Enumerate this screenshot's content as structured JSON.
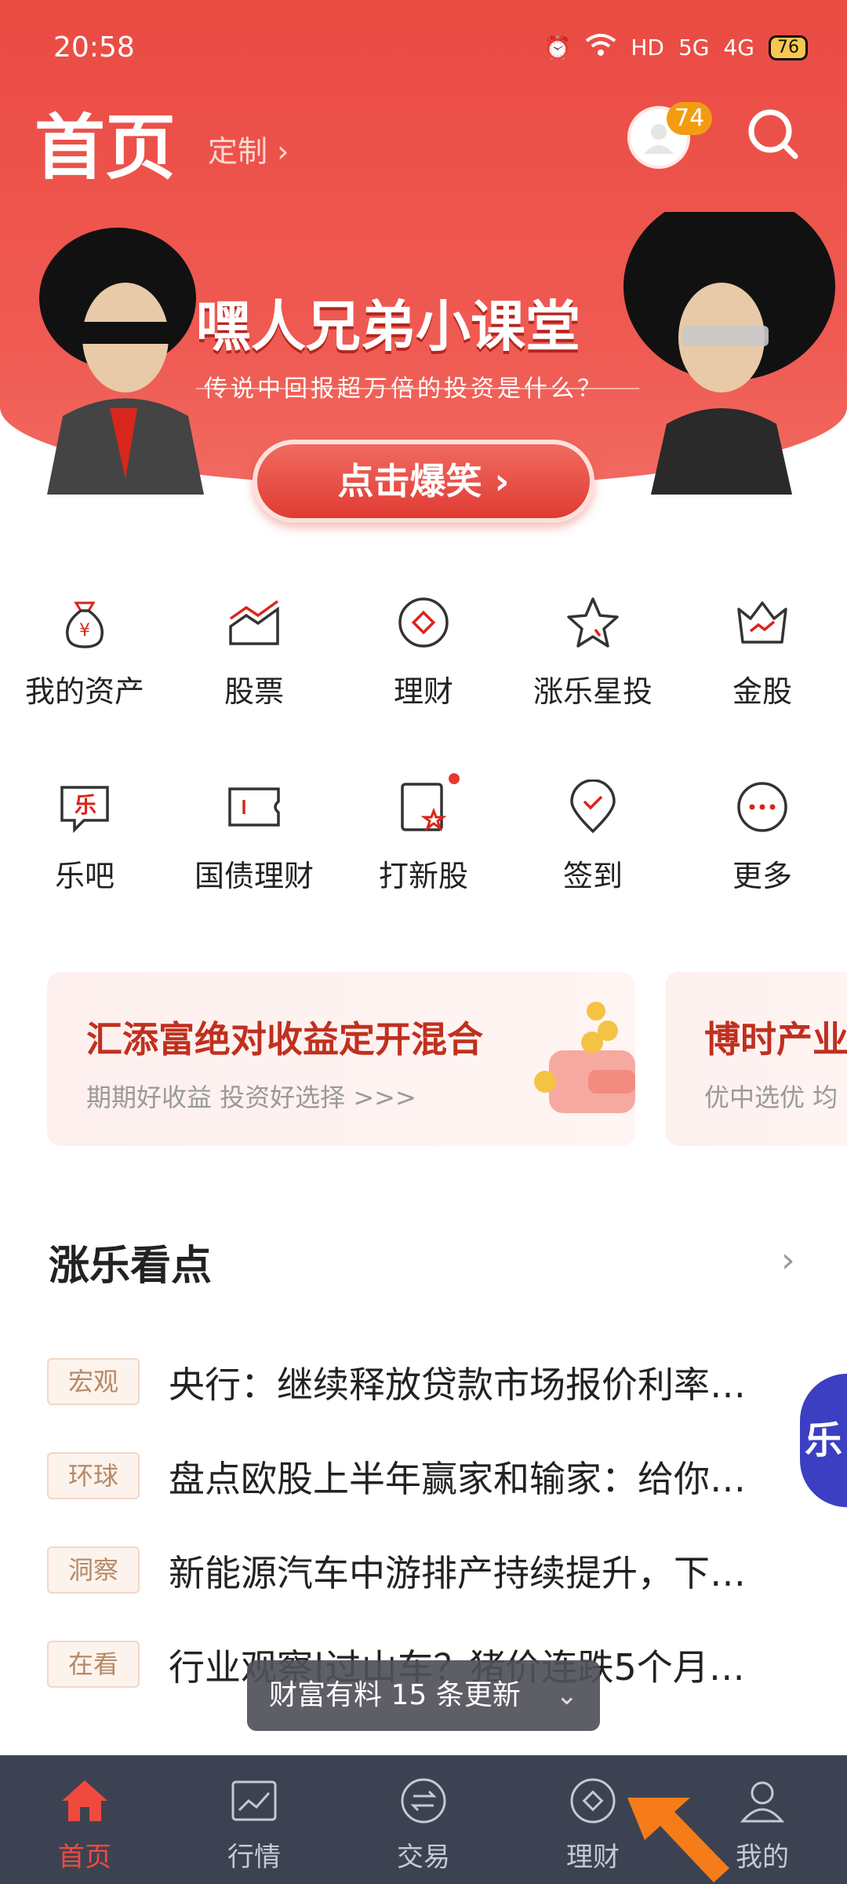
{
  "status_bar": {
    "time": "20:58",
    "indicators": [
      "alarm-icon",
      "wifi-icon",
      "HD",
      "5G",
      "4G"
    ],
    "battery": "76"
  },
  "header": {
    "title": "首页",
    "customize": "定制",
    "badge_count": "74"
  },
  "banner": {
    "title": "嘿人兄弟小课堂",
    "subtitle": "传说中回报超万倍的投资是什么？",
    "cta": "点击爆笑"
  },
  "grid": [
    {
      "label": "我的资产",
      "icon": "money-bag-icon"
    },
    {
      "label": "股票",
      "icon": "stock-chart-icon"
    },
    {
      "label": "理财",
      "icon": "finance-coin-icon"
    },
    {
      "label": "涨乐星投",
      "icon": "star-icon"
    },
    {
      "label": "金股",
      "icon": "crown-icon"
    },
    {
      "label": "乐吧",
      "icon": "chat-le-icon"
    },
    {
      "label": "国债理财",
      "icon": "ticket-icon"
    },
    {
      "label": "打新股",
      "icon": "new-stock-icon"
    },
    {
      "label": "签到",
      "icon": "location-check-icon"
    },
    {
      "label": "更多",
      "icon": "more-dots-icon"
    }
  ],
  "promos": [
    {
      "title": "汇添富绝对收益定开混合",
      "subtitle": "期期好收益 投资好选择 >>>"
    },
    {
      "title": "博时产业",
      "subtitle": "优中选优 均"
    }
  ],
  "section": {
    "title": "涨乐看点"
  },
  "news": [
    {
      "tag": "宏观",
      "headline": "央行：继续释放贷款市场报价利率…"
    },
    {
      "tag": "环球",
      "headline": "盘点欧股上半年赢家和输家：给你…"
    },
    {
      "tag": "洞察",
      "headline": "新能源汽车中游排产持续提升，下…"
    },
    {
      "tag": "在看",
      "headline": "行业观察|过山车？猪价连跌5个月…"
    }
  ],
  "toast": {
    "text": "财富有料 15 条更新"
  },
  "tabbar": [
    {
      "label": "首页",
      "icon": "home-icon",
      "active": true
    },
    {
      "label": "行情",
      "icon": "market-chart-icon",
      "active": false
    },
    {
      "label": "交易",
      "icon": "exchange-icon",
      "active": false
    },
    {
      "label": "理财",
      "icon": "finance-coin-icon",
      "active": false
    },
    {
      "label": "我的",
      "icon": "profile-icon",
      "active": false
    }
  ],
  "colors": {
    "brand_red": "#ea4b43",
    "tabbar_bg": "#3d4252",
    "active_tab": "#f04a3f",
    "promo_title": "#c0301f"
  }
}
